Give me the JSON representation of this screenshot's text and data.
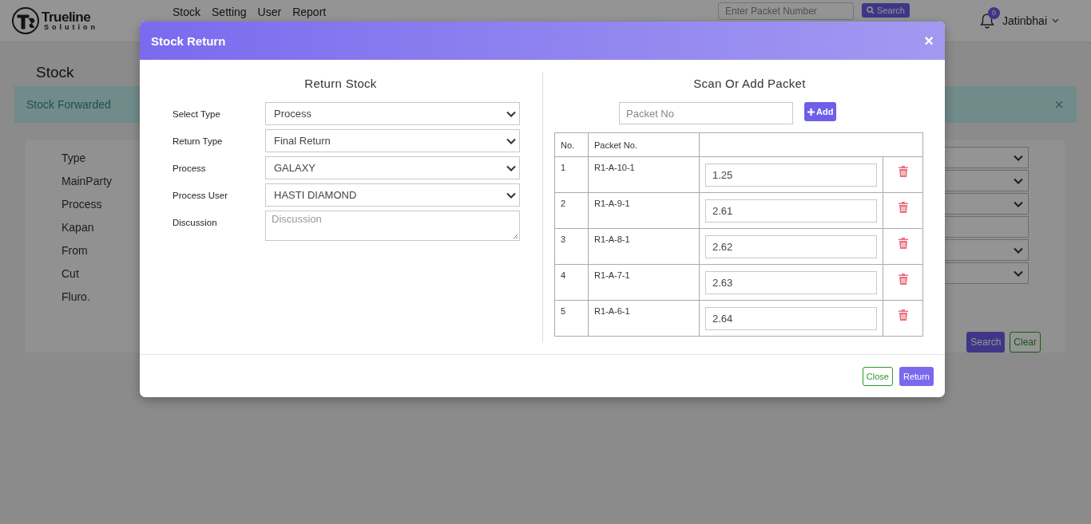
{
  "header": {
    "logo": {
      "name": "Trueline",
      "tagline": "Solution"
    },
    "nav": [
      {
        "label": "Stock"
      },
      {
        "label": "Setting"
      },
      {
        "label": "User"
      },
      {
        "label": "Report"
      }
    ],
    "search": {
      "placeholder": "Enter Packet Number",
      "button": "Search"
    },
    "notifications": {
      "count": "0"
    },
    "user": "Jatinbhai"
  },
  "page": {
    "title": "Stock",
    "alert": {
      "message": "Stock Forwarded",
      "close": "×"
    },
    "filters": [
      {
        "label": "Type",
        "kind": "select"
      },
      {
        "label": "MainParty",
        "kind": "select"
      },
      {
        "label": "Process",
        "kind": "select"
      },
      {
        "label": "Kapan",
        "kind": "input"
      },
      {
        "label": "From",
        "kind": "select"
      },
      {
        "label": "Cut",
        "kind": "select"
      },
      {
        "label": "Fluro.",
        "kind": "none"
      }
    ],
    "buttons": [
      {
        "label": "Search",
        "kind": "primary"
      },
      {
        "label": "Clear",
        "kind": "outline"
      }
    ]
  },
  "modal": {
    "title": "Stock Return",
    "close": "×",
    "left": {
      "heading": "Return Stock",
      "fields": [
        {
          "label": "Select Type",
          "kind": "select",
          "value": "Process"
        },
        {
          "label": "Return Type",
          "kind": "select",
          "value": "Final Return"
        },
        {
          "label": "Process",
          "kind": "select",
          "value": "GALAXY"
        },
        {
          "label": "Process User",
          "kind": "select",
          "value": "HASTI DIAMOND"
        },
        {
          "label": "Discussion",
          "kind": "textarea",
          "placeholder": "Discussion"
        }
      ]
    },
    "right": {
      "heading": "Scan Or Add Packet",
      "packet_field": {
        "placeholder": "Packet No"
      },
      "add_button": "Add",
      "table": {
        "columns": [
          "No.",
          "Packet No."
        ],
        "rows": [
          {
            "no": "1",
            "packet": "R1-A-10-1",
            "weight": "1.25"
          },
          {
            "no": "2",
            "packet": "R1-A-9-1",
            "weight": "2.61"
          },
          {
            "no": "3",
            "packet": "R1-A-8-1",
            "weight": "2.62"
          },
          {
            "no": "4",
            "packet": "R1-A-7-1",
            "weight": "2.63"
          },
          {
            "no": "5",
            "packet": "R1-A-6-1",
            "weight": "2.64"
          }
        ]
      }
    },
    "buttons": [
      {
        "label": "Close",
        "kind": "outline"
      },
      {
        "label": "Return",
        "kind": "primary"
      }
    ]
  }
}
